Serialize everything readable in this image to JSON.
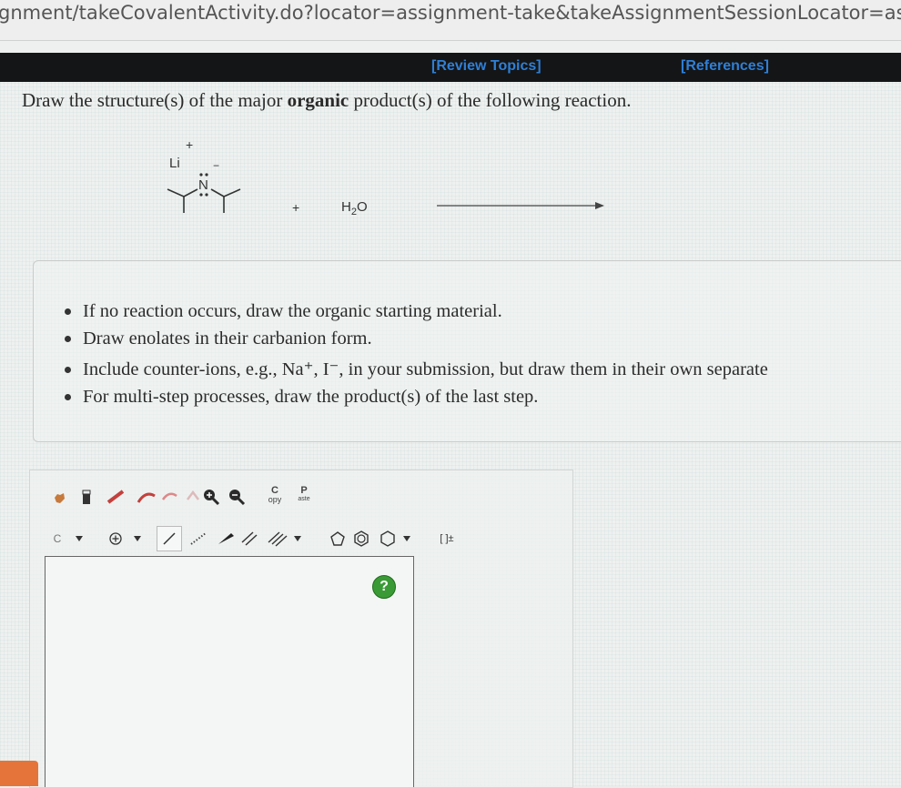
{
  "browser": {
    "url": "gnment/takeCovalentActivity.do?locator=assignment-take&takeAssignmentSessionLocator=assig"
  },
  "topbar": {
    "review_topics": "[Review Topics]",
    "references": "[References]"
  },
  "question": {
    "prefix": "Draw the structure(s) of the major ",
    "bold": "organic",
    "suffix": " product(s) of the following reaction."
  },
  "reaction": {
    "cation": "Li",
    "cation_charge": "+",
    "anion_charge": "−",
    "nitrogen": "N",
    "plus": "+",
    "reagent": "H",
    "reagent_sub": "2",
    "reagent_tail": "O"
  },
  "instructions": [
    "If no reaction occurs, draw the organic starting material.",
    "Draw enolates in their carbanion form.",
    "Include counter-ions, e.g., Na⁺, I⁻, in your submission, but draw them in their own separate",
    "For multi-step processes, draw the product(s) of the last step."
  ],
  "toolbar": {
    "copy_top": "C",
    "copy_bottom": "opy",
    "paste_top": "P",
    "paste_bottom": "aste",
    "element_selector": "C",
    "bracket_tool": "[ ]±",
    "help": "?"
  },
  "icons": [
    "hand-icon",
    "eraser-icon",
    "pencil-icon",
    "lasso-icon",
    "zoom-in-icon",
    "zoom-out-icon",
    "charge-icon",
    "single-bond-icon",
    "hashed-bond-icon",
    "wedge-bond-icon",
    "double-bond-icon",
    "triple-bond-icon",
    "cyclopentane-icon",
    "benzene-icon",
    "cyclohexane-icon"
  ],
  "colors": {
    "link": "#2f7fd6",
    "help_button": "#3a9a35",
    "topbar": "#141516"
  }
}
